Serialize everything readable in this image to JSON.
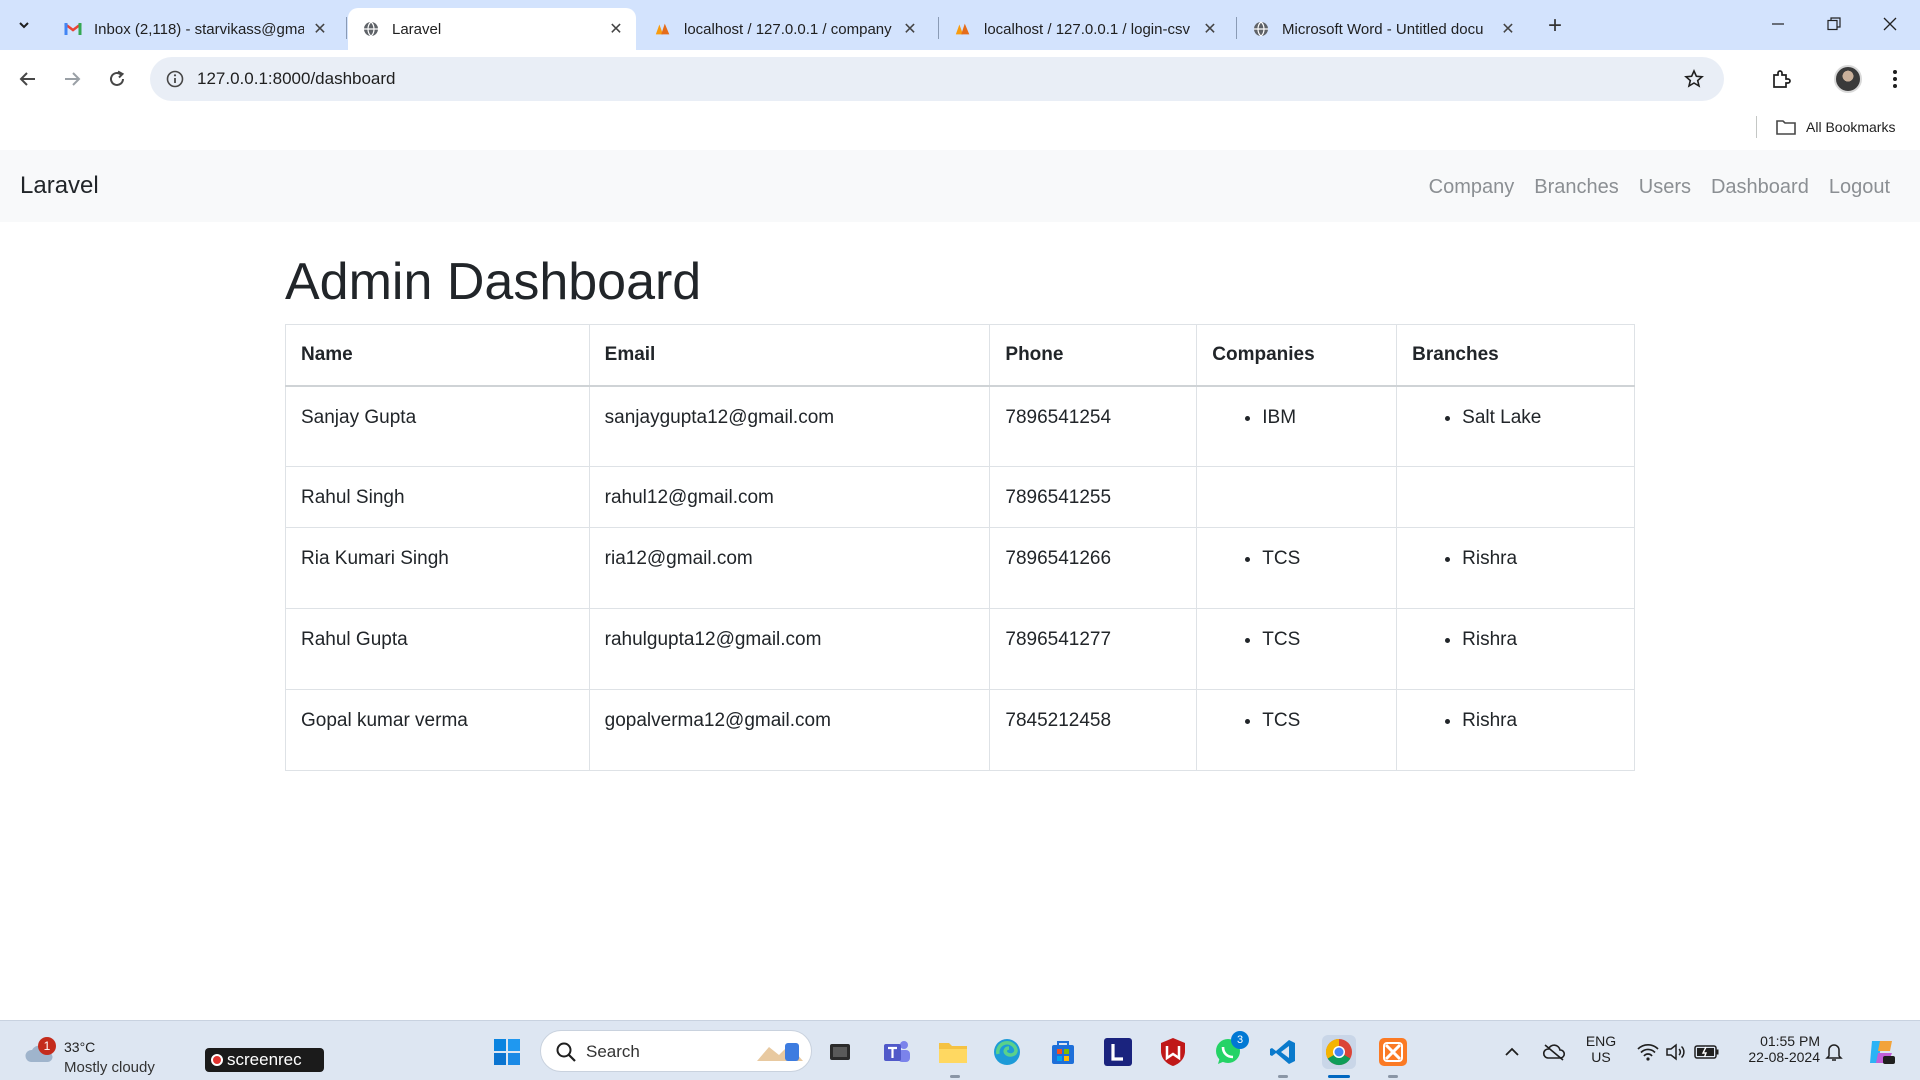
{
  "browser": {
    "tabs": [
      {
        "title": "Inbox (2,118) - starvikass@gma",
        "icon": "gmail-icon",
        "active": false
      },
      {
        "title": "Laravel",
        "icon": "globe-icon",
        "active": true
      },
      {
        "title": "localhost / 127.0.0.1 / company",
        "icon": "phpmyadmin-icon",
        "active": false
      },
      {
        "title": "localhost / 127.0.0.1 / login-csv",
        "icon": "phpmyadmin-icon",
        "active": false
      },
      {
        "title": "Microsoft Word - Untitled docu",
        "icon": "globe-icon",
        "active": false
      }
    ],
    "url": "127.0.0.1:8000/dashboard",
    "bookmarks_label": "All Bookmarks"
  },
  "navbar": {
    "brand": "Laravel",
    "links": [
      "Company",
      "Branches",
      "Users",
      "Dashboard",
      "Logout"
    ]
  },
  "main": {
    "title": "Admin Dashboard",
    "table": {
      "headers": [
        "Name",
        "Email",
        "Phone",
        "Companies",
        "Branches"
      ],
      "rows": [
        {
          "name": "Sanjay Gupta",
          "email": "sanjaygupta12@gmail.com",
          "phone": "7896541254",
          "companies": [
            "IBM"
          ],
          "branches": [
            "Salt Lake"
          ]
        },
        {
          "name": "Rahul Singh",
          "email": "rahul12@gmail.com",
          "phone": "7896541255",
          "companies": [],
          "branches": []
        },
        {
          "name": "Ria Kumari Singh",
          "email": "ria12@gmail.com",
          "phone": "7896541266",
          "companies": [
            "TCS"
          ],
          "branches": [
            "Rishra"
          ]
        },
        {
          "name": "Rahul Gupta",
          "email": "rahulgupta12@gmail.com",
          "phone": "7896541277",
          "companies": [
            "TCS"
          ],
          "branches": [
            "Rishra"
          ]
        },
        {
          "name": "Gopal kumar verma",
          "email": "gopalverma12@gmail.com",
          "phone": "7845212458",
          "companies": [
            "TCS"
          ],
          "branches": [
            "Rishra"
          ]
        }
      ]
    }
  },
  "taskbar": {
    "weather": {
      "badge": "1",
      "temp": "33°C",
      "condition": "Mostly cloudy"
    },
    "screenrec_label": "screenrec",
    "search_label": "Search",
    "whatsapp_badge": "3",
    "lang": "ENG",
    "region": "US",
    "time": "01:55 PM",
    "date": "22-08-2024"
  },
  "colors": {
    "tabstrip": "#d3e3fd",
    "navbar_bg": "#f8f9fa",
    "nav_link": "#8b8f93",
    "taskbar": "#dde6f2"
  }
}
